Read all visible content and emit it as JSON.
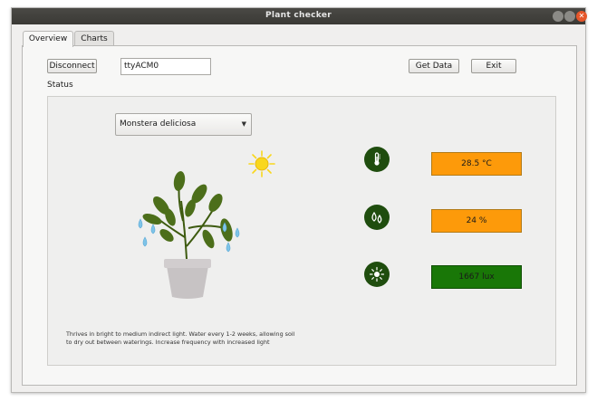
{
  "window": {
    "title": "Plant checker"
  },
  "tabs": [
    {
      "label": "Overview",
      "active": true
    },
    {
      "label": "Charts",
      "active": false
    }
  ],
  "toolbar": {
    "disconnect_label": "Disconnect",
    "port_value": "ttyACM0",
    "get_data_label": "Get Data",
    "exit_label": "Exit"
  },
  "status": {
    "label": "Status",
    "plant_select": "Monstera deliciosa",
    "description": "Thrives in bright to medium indirect light. Water every 1-2 weeks, allowing soil to dry out between waterings. Increase frequency with increased light",
    "readings": [
      {
        "icon": "thermometer-icon",
        "value": "28.5 °C",
        "status_color": "#fd9a0a"
      },
      {
        "icon": "water-drops-icon",
        "value": "24 %",
        "status_color": "#fd9a0a"
      },
      {
        "icon": "light-icon",
        "value": "1667 lux",
        "status_color": "#197707"
      }
    ]
  },
  "colors": {
    "icon_green": "#1f4d0e",
    "warning": "#fd9a0a",
    "ok": "#197707",
    "sun": "#f9d71c"
  }
}
